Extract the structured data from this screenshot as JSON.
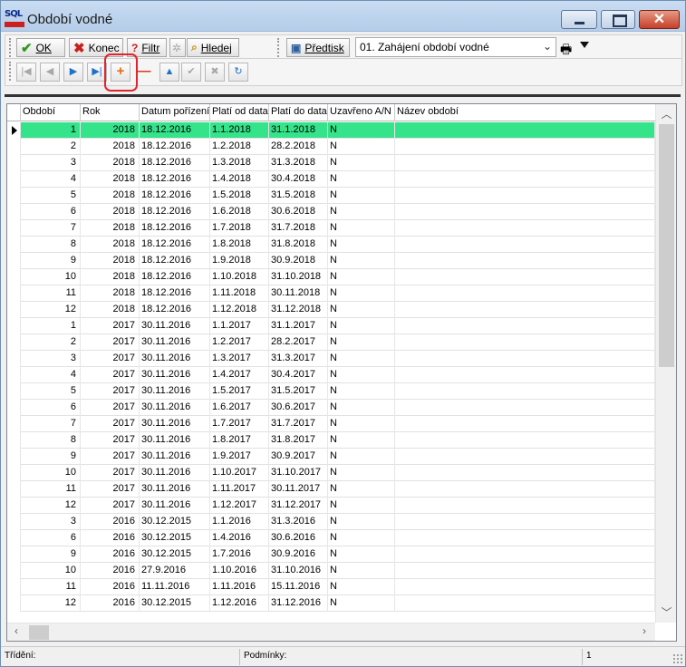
{
  "window": {
    "title": "Období vodné",
    "app_logo_text": "SQL"
  },
  "toolbar": {
    "ok_label": "OK",
    "close_label": "Konec",
    "filter_label": "Filtr",
    "search_label": "Hledej",
    "template_label": "Předtisk",
    "template_select_value": "01. Zahájení období vodné"
  },
  "navigator": {
    "buttons": [
      "first",
      "prior",
      "next",
      "last",
      "insert",
      "delete",
      "edit",
      "post",
      "cancel",
      "refresh"
    ]
  },
  "grid": {
    "columns": [
      "Období",
      "Rok",
      "Datum pořízení",
      "Platí od data",
      "Platí do data",
      "Uzavřeno A/N",
      "Název období"
    ],
    "rows": [
      [
        "1",
        "2018",
        "18.12.2016",
        "1.1.2018",
        "31.1.2018",
        "N",
        ""
      ],
      [
        "2",
        "2018",
        "18.12.2016",
        "1.2.2018",
        "28.2.2018",
        "N",
        ""
      ],
      [
        "3",
        "2018",
        "18.12.2016",
        "1.3.2018",
        "31.3.2018",
        "N",
        ""
      ],
      [
        "4",
        "2018",
        "18.12.2016",
        "1.4.2018",
        "30.4.2018",
        "N",
        ""
      ],
      [
        "5",
        "2018",
        "18.12.2016",
        "1.5.2018",
        "31.5.2018",
        "N",
        ""
      ],
      [
        "6",
        "2018",
        "18.12.2016",
        "1.6.2018",
        "30.6.2018",
        "N",
        ""
      ],
      [
        "7",
        "2018",
        "18.12.2016",
        "1.7.2018",
        "31.7.2018",
        "N",
        ""
      ],
      [
        "8",
        "2018",
        "18.12.2016",
        "1.8.2018",
        "31.8.2018",
        "N",
        ""
      ],
      [
        "9",
        "2018",
        "18.12.2016",
        "1.9.2018",
        "30.9.2018",
        "N",
        ""
      ],
      [
        "10",
        "2018",
        "18.12.2016",
        "1.10.2018",
        "31.10.2018",
        "N",
        ""
      ],
      [
        "11",
        "2018",
        "18.12.2016",
        "1.11.2018",
        "30.11.2018",
        "N",
        ""
      ],
      [
        "12",
        "2018",
        "18.12.2016",
        "1.12.2018",
        "31.12.2018",
        "N",
        ""
      ],
      [
        "1",
        "2017",
        "30.11.2016",
        "1.1.2017",
        "31.1.2017",
        "N",
        ""
      ],
      [
        "2",
        "2017",
        "30.11.2016",
        "1.2.2017",
        "28.2.2017",
        "N",
        ""
      ],
      [
        "3",
        "2017",
        "30.11.2016",
        "1.3.2017",
        "31.3.2017",
        "N",
        ""
      ],
      [
        "4",
        "2017",
        "30.11.2016",
        "1.4.2017",
        "30.4.2017",
        "N",
        ""
      ],
      [
        "5",
        "2017",
        "30.11.2016",
        "1.5.2017",
        "31.5.2017",
        "N",
        ""
      ],
      [
        "6",
        "2017",
        "30.11.2016",
        "1.6.2017",
        "30.6.2017",
        "N",
        ""
      ],
      [
        "7",
        "2017",
        "30.11.2016",
        "1.7.2017",
        "31.7.2017",
        "N",
        ""
      ],
      [
        "8",
        "2017",
        "30.11.2016",
        "1.8.2017",
        "31.8.2017",
        "N",
        ""
      ],
      [
        "9",
        "2017",
        "30.11.2016",
        "1.9.2017",
        "30.9.2017",
        "N",
        ""
      ],
      [
        "10",
        "2017",
        "30.11.2016",
        "1.10.2017",
        "31.10.2017",
        "N",
        ""
      ],
      [
        "11",
        "2017",
        "30.11.2016",
        "1.11.2017",
        "30.11.2017",
        "N",
        ""
      ],
      [
        "12",
        "2017",
        "30.11.2016",
        "1.12.2017",
        "31.12.2017",
        "N",
        ""
      ],
      [
        "3",
        "2016",
        "30.12.2015",
        "1.1.2016",
        "31.3.2016",
        "N",
        ""
      ],
      [
        "6",
        "2016",
        "30.12.2015",
        "1.4.2016",
        "30.6.2016",
        "N",
        ""
      ],
      [
        "9",
        "2016",
        "30.12.2015",
        "1.7.2016",
        "30.9.2016",
        "N",
        ""
      ],
      [
        "10",
        "2016",
        "27.9.2016",
        "1.10.2016",
        "31.10.2016",
        "N",
        ""
      ],
      [
        "11",
        "2016",
        "11.11.2016",
        "1.11.2016",
        "15.11.2016",
        "N",
        ""
      ],
      [
        "12",
        "2016",
        "30.12.2015",
        "1.12.2016",
        "31.12.2016",
        "N",
        ""
      ]
    ],
    "selected_row_index": 0,
    "selected_color": "#34e38a"
  },
  "statusbar": {
    "sort_label": "Třídění:",
    "conditions_label": "Podmínky:",
    "record_count": "1"
  }
}
